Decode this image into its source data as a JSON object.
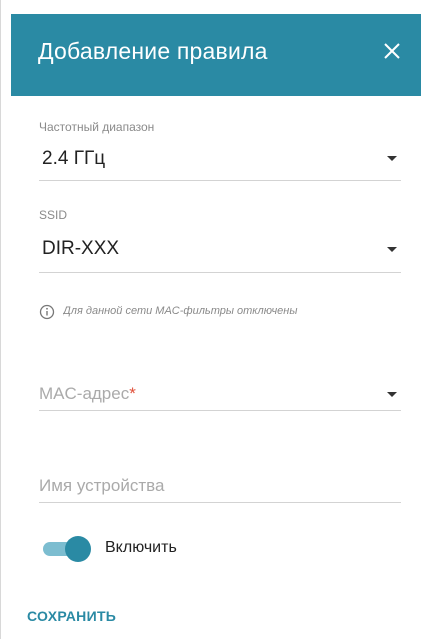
{
  "dialog": {
    "title": "Добавление правила",
    "close_icon": "close-icon"
  },
  "fields": {
    "band": {
      "label": "Частотный диапазон",
      "value": "2.4 ГГц"
    },
    "ssid": {
      "label": "SSID",
      "value": "DIR-XXX"
    },
    "note": {
      "text": "Для данной сети MAC-фильтры отключены",
      "icon": "info-icon"
    },
    "mac": {
      "placeholder": "MAC-адрес",
      "required_mark": "*"
    },
    "device_name": {
      "placeholder": "Имя устройства"
    },
    "enable": {
      "label": "Включить",
      "checked": true
    }
  },
  "actions": {
    "save_label": "СОХРАНИТЬ"
  },
  "colors": {
    "accent": "#2a8aa4",
    "toggle_track": "#7cbdd0",
    "required": "#e0503a"
  }
}
